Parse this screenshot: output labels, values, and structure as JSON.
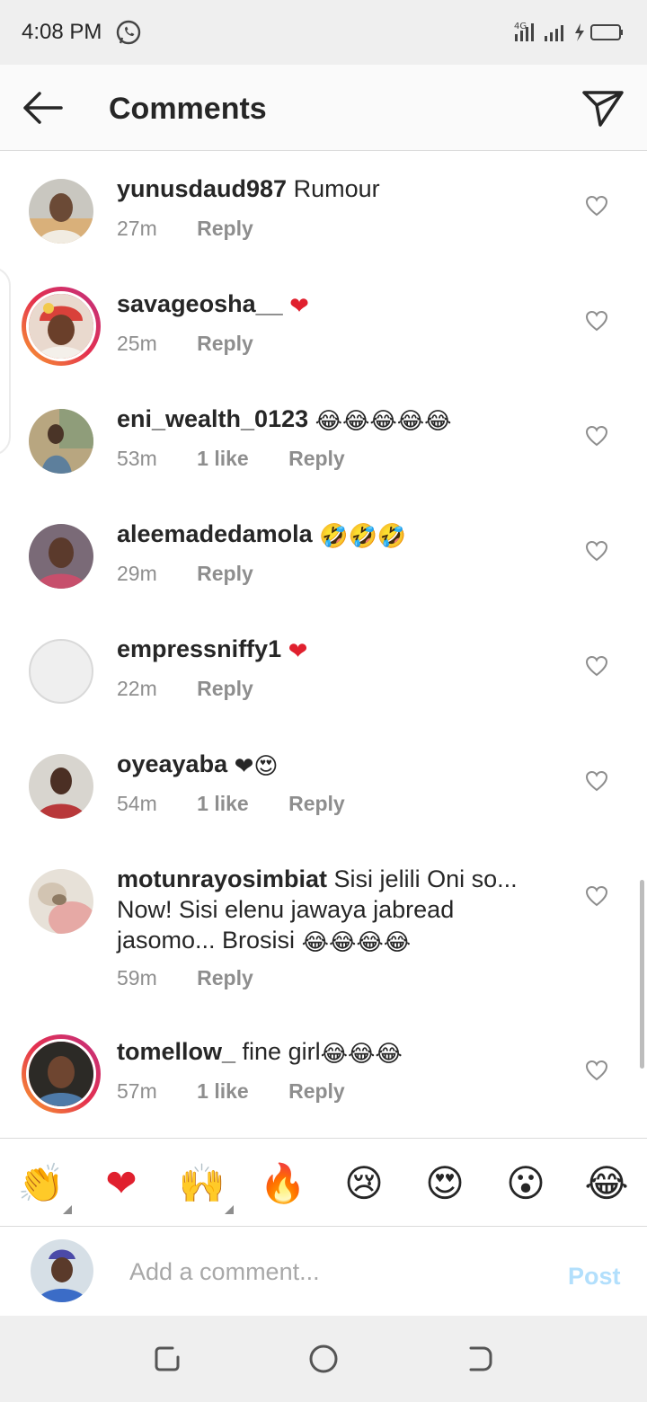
{
  "status_bar": {
    "time": "4:08 PM",
    "network": "4G"
  },
  "header": {
    "title": "Comments"
  },
  "comments": [
    {
      "user": "yunusdaud987",
      "text": " Rumour",
      "emoji": "",
      "time": "27m",
      "likes": "",
      "reply": "Reply"
    },
    {
      "user": "savageosha__",
      "text": " ",
      "emoji": "❤",
      "time": "25m",
      "likes": "",
      "reply": "Reply"
    },
    {
      "user": "eni_wealth_0123",
      "text": " ",
      "emoji": "😂😂😂😂😂",
      "time": "53m",
      "likes": "1 like",
      "reply": "Reply"
    },
    {
      "user": "aleemadedamola",
      "text": " ",
      "emoji": "🤣🤣🤣",
      "time": "29m",
      "likes": "",
      "reply": "Reply"
    },
    {
      "user": "empressniffy1",
      "text": " ",
      "emoji": "❤",
      "time": "22m",
      "likes": "",
      "reply": "Reply"
    },
    {
      "user": "oyeayaba",
      "text": " ",
      "emoji": "❤😍",
      "time": "54m",
      "likes": "1 like",
      "reply": "Reply"
    },
    {
      "user": "motunrayosimbiat",
      "text": " Sisi jelili Oni so... Now! Sisi elenu jawaya jabread jasomo... Brosisi ",
      "emoji": "😂😂😂😂",
      "time": "59m",
      "likes": "",
      "reply": "Reply"
    },
    {
      "user": "tomellow_",
      "text": " fine girl",
      "emoji": "😂😂😂",
      "time": "57m",
      "likes": "1 like",
      "reply": "Reply"
    }
  ],
  "reactions": [
    "👏",
    "❤",
    "🙌",
    "🔥",
    "😢",
    "😍",
    "😮",
    "😂"
  ],
  "composer": {
    "placeholder": "Add a comment...",
    "post_label": "Post"
  },
  "colors": {
    "like_heart": "#e0202e",
    "post_disabled": "#b2dffc",
    "story_ring": "#e4304f"
  }
}
